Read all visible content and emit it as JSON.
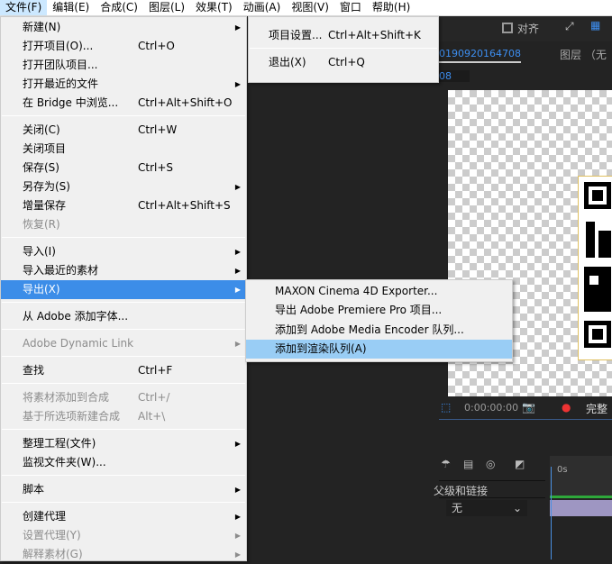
{
  "menubar": [
    "文件(F)",
    "编辑(E)",
    "合成(C)",
    "图层(L)",
    "效果(T)",
    "动画(A)",
    "视图(V)",
    "窗口",
    "帮助(H)"
  ],
  "file_menu": [
    {
      "label": "新建(N)",
      "arrow": true
    },
    {
      "label": "打开项目(O)...",
      "shortcut": "Ctrl+O"
    },
    {
      "label": "打开团队项目..."
    },
    {
      "label": "打开最近的文件",
      "arrow": true
    },
    {
      "label": "在 Bridge 中浏览...",
      "shortcut": "Ctrl+Alt+Shift+O"
    },
    {
      "label": "关闭(C)",
      "shortcut": "Ctrl+W"
    },
    {
      "label": "关闭项目"
    },
    {
      "label": "保存(S)",
      "shortcut": "Ctrl+S"
    },
    {
      "label": "另存为(S)",
      "arrow": true
    },
    {
      "label": "增量保存",
      "shortcut": "Ctrl+Alt+Shift+S"
    },
    {
      "label": "恢复(R)",
      "disabled": true
    },
    {
      "label": "导入(I)",
      "arrow": true
    },
    {
      "label": "导入最近的素材",
      "arrow": true
    },
    {
      "label": "导出(X)",
      "arrow": true,
      "highlighted": true
    },
    {
      "label": "从 Adobe 添加字体..."
    },
    {
      "label": "Adobe Dynamic Link",
      "arrow": true,
      "disabled": true
    },
    {
      "label": "查找",
      "shortcut": "Ctrl+F"
    },
    {
      "label": "将素材添加到合成",
      "shortcut": "Ctrl+/",
      "disabled": true
    },
    {
      "label": "基于所选项新建合成",
      "shortcut": "Alt+\\",
      "disabled": true
    },
    {
      "label": "整理工程(文件)",
      "arrow": true
    },
    {
      "label": "监视文件夹(W)..."
    },
    {
      "label": "脚本",
      "arrow": true
    },
    {
      "label": "创建代理",
      "arrow": true
    },
    {
      "label": "设置代理(Y)",
      "arrow": true,
      "disabled": true
    },
    {
      "label": "解释素材(G)",
      "arrow": true,
      "disabled": true
    }
  ],
  "project_menu": [
    {
      "label": "项目设置...",
      "shortcut": "Ctrl+Alt+Shift+K"
    },
    {
      "label": "退出(X)",
      "shortcut": "Ctrl+Q"
    }
  ],
  "export_menu": [
    {
      "label": "MAXON Cinema 4D Exporter..."
    },
    {
      "label": "导出 Adobe Premiere Pro 项目..."
    },
    {
      "label": "添加到 Adobe Media Encoder 队列..."
    },
    {
      "label": "添加到渲染队列(A)",
      "highlighted": true
    }
  ],
  "ae": {
    "snap_label": "对齐",
    "comp_name": "0190920164708",
    "comp_tab": "08",
    "layer_panel": "图层 （无",
    "timecode": "0:00:00:00",
    "resolution": "完整",
    "parent_header": "父级和链接",
    "parent_value": "无",
    "ruler_start": "0s"
  }
}
